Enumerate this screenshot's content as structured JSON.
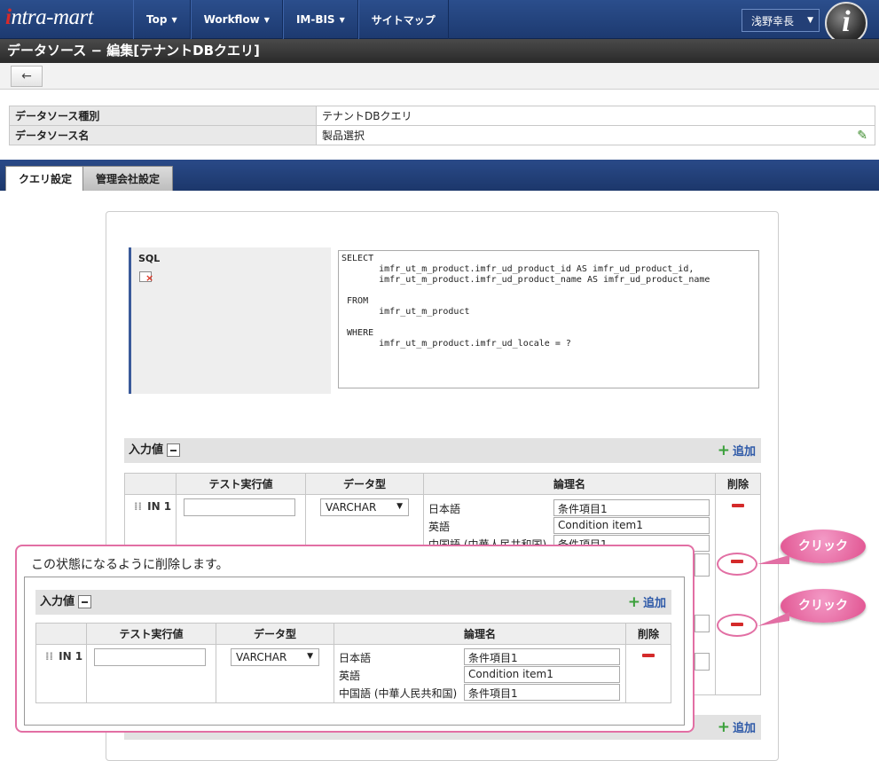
{
  "header": {
    "logo": "intra-mart",
    "nav": [
      {
        "label": "Top"
      },
      {
        "label": "Workflow"
      },
      {
        "label": "IM-BIS"
      },
      {
        "label": "サイトマップ"
      }
    ],
    "user_name": "浅野幸長",
    "badge_letter": "i"
  },
  "page_title": "データソース − 編集[テナントDBクエリ]",
  "toolbar": {
    "back_icon": "←"
  },
  "info": {
    "type_label": "データソース種別",
    "type_value": "テナントDBクエリ",
    "name_label": "データソース名",
    "name_value": "製品選択"
  },
  "tabs": {
    "query": "クエリ設定",
    "company": "管理会社設定"
  },
  "sql": {
    "label": "SQL",
    "text": "SELECT\n       imfr_ut_m_product.imfr_ud_product_id AS imfr_ud_product_id,\n       imfr_ut_m_product.imfr_ud_product_name AS imfr_ud_product_name\n\n FROM\n       imfr_ut_m_product\n\n WHERE\n       imfr_ut_m_product.imfr_ud_locale = ?"
  },
  "inputs": {
    "title": "入力値",
    "add_label": "追加",
    "columns": {
      "test": "テスト実行値",
      "type": "データ型",
      "logical": "論理名",
      "delete": "削除"
    },
    "row": {
      "id": "IN 1",
      "type": "VARCHAR",
      "langs": [
        {
          "lang": "日本語",
          "value": "条件項目1"
        },
        {
          "lang": "英語",
          "value": "Condition item1"
        },
        {
          "lang": "中国語 (中華人民共和国)",
          "value": "条件項目1"
        }
      ]
    }
  },
  "callout": {
    "text": "この状態になるように削除します。",
    "click_label": "クリック"
  },
  "colors": {
    "nav": "#1d3a70",
    "accent_pink": "#e26fa4",
    "delete_red": "#d42a2a",
    "add_green": "#3aa03a"
  }
}
